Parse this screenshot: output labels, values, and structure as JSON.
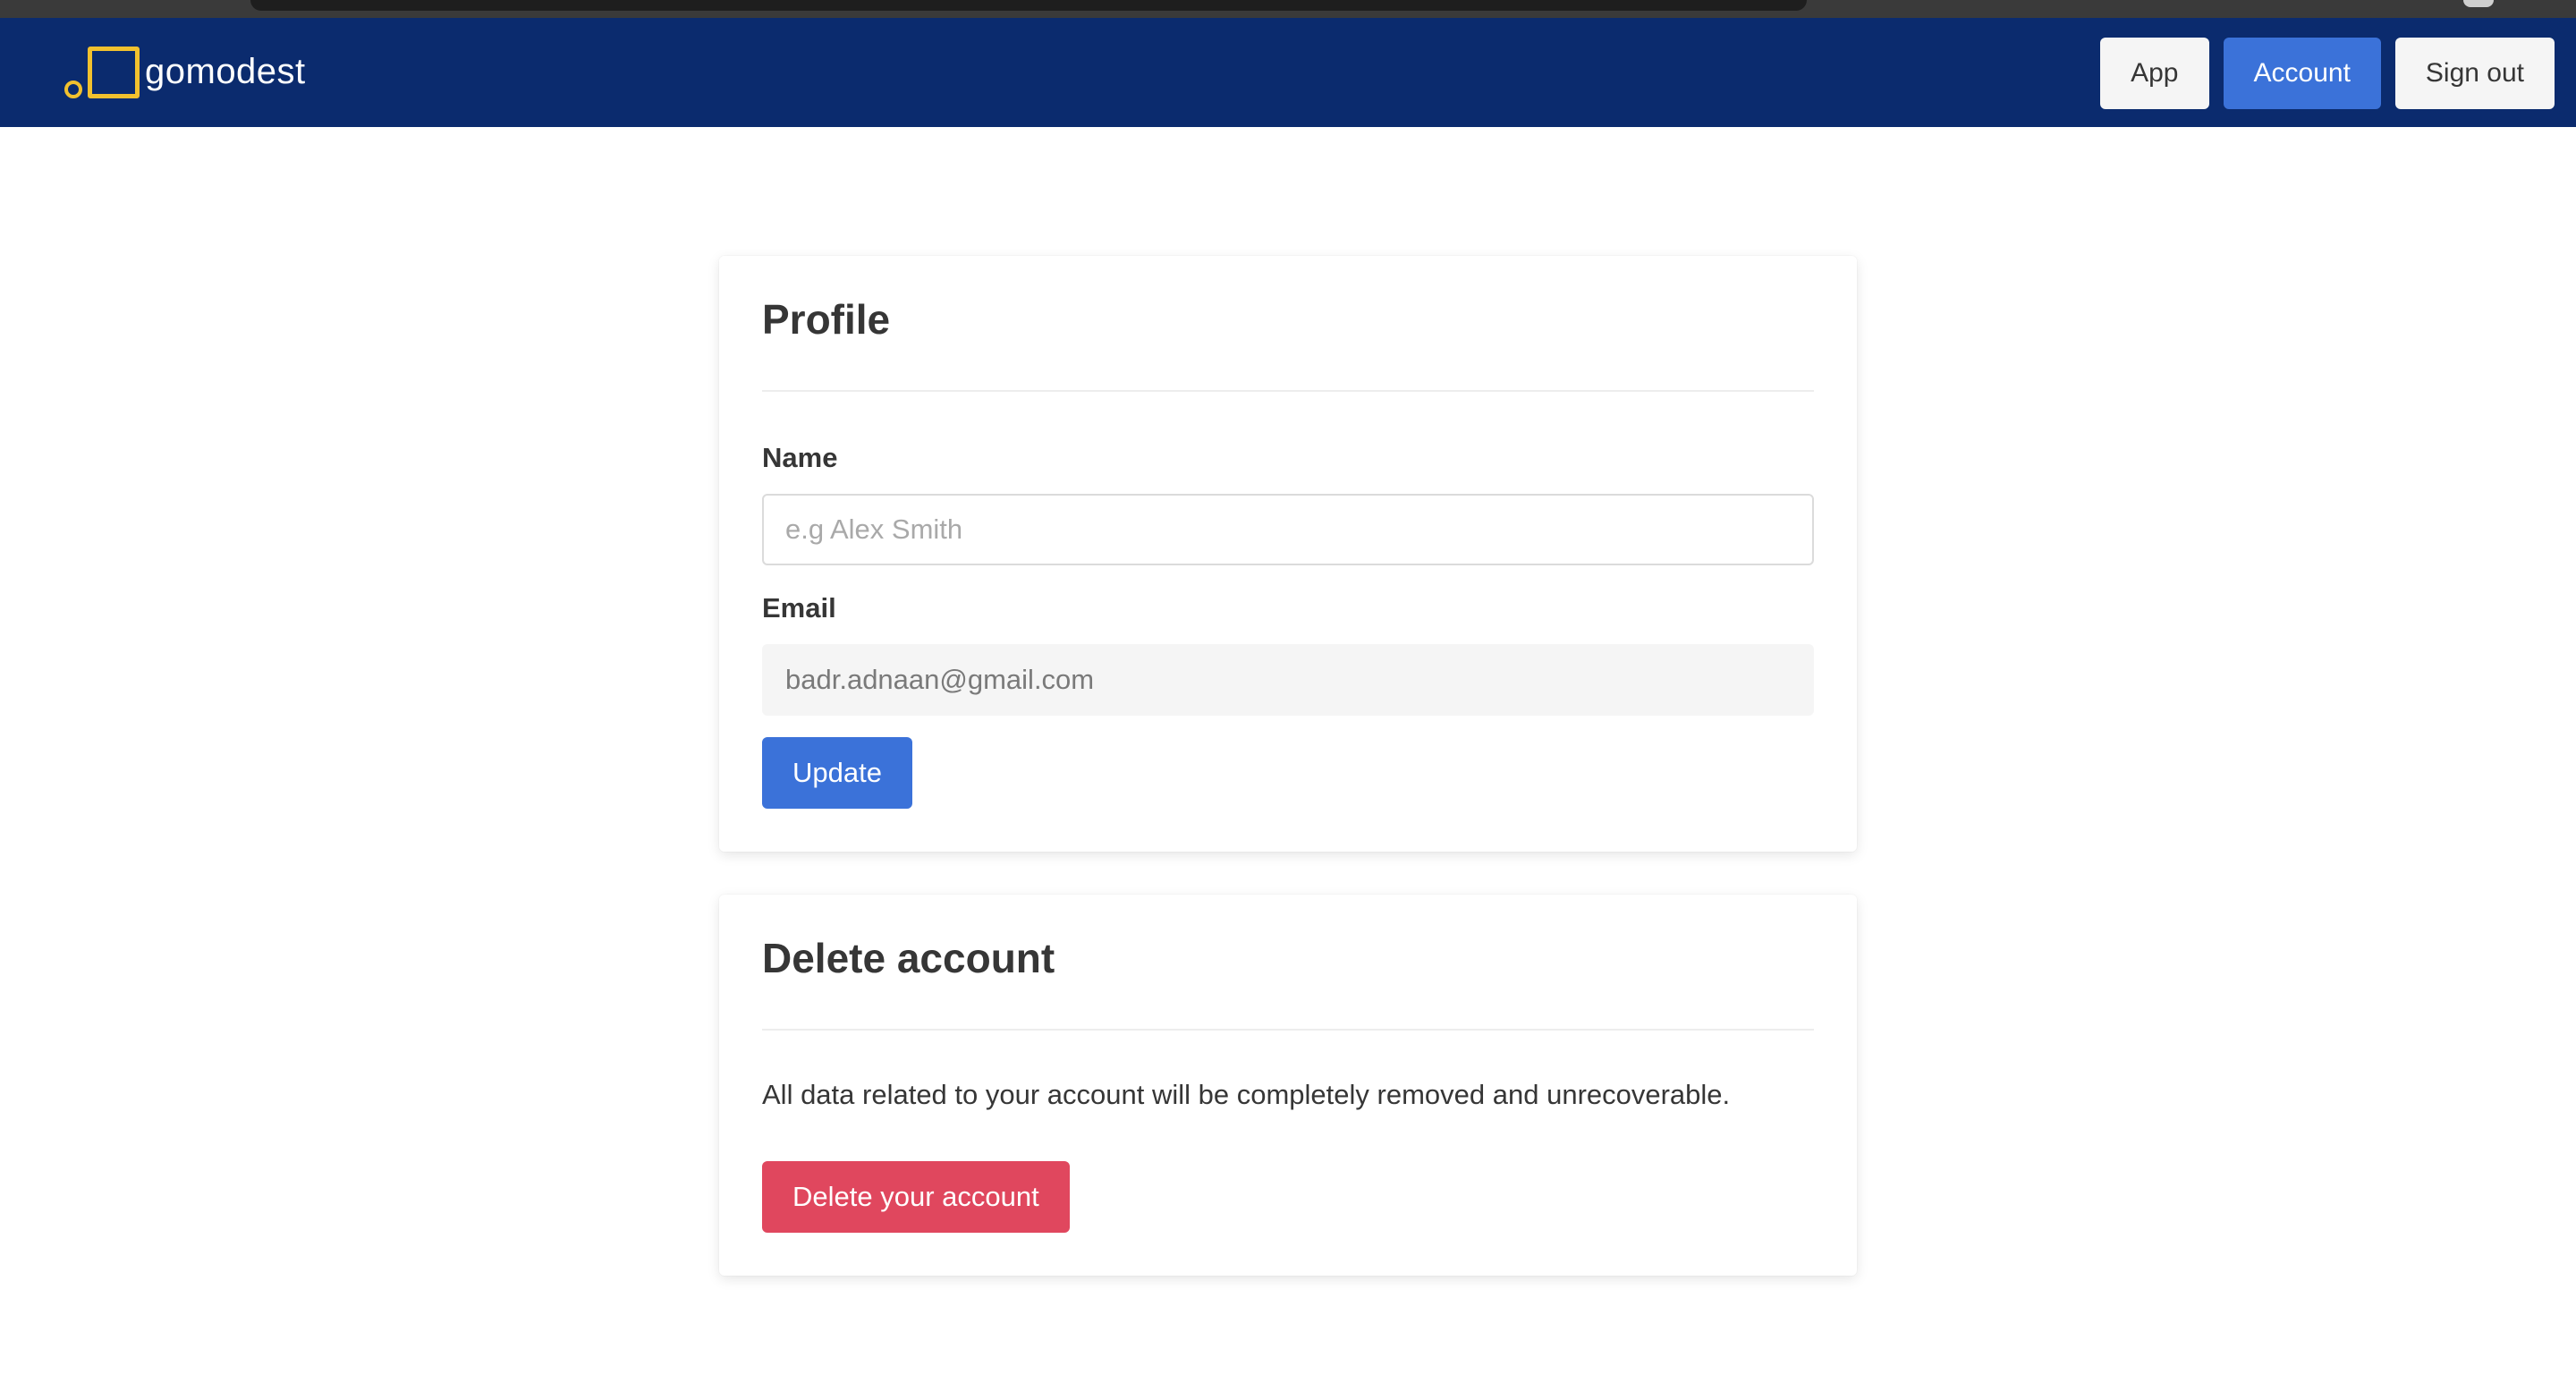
{
  "navbar": {
    "brand_name": "gomodest",
    "buttons": [
      {
        "label": "App"
      },
      {
        "label": "Account"
      },
      {
        "label": "Sign out"
      }
    ]
  },
  "profile": {
    "title": "Profile",
    "name_label": "Name",
    "name_value": "",
    "name_placeholder": "e.g Alex Smith",
    "email_label": "Email",
    "email_value": "badr.adnaan@gmail.com",
    "update_label": "Update"
  },
  "delete_account": {
    "title": "Delete account",
    "description": "All data related to your account will be completely removed and unrecoverable.",
    "button_label": "Delete your account"
  },
  "colors": {
    "navbar_bg": "#0b2b6e",
    "logo_accent": "#f2c12e",
    "primary": "#3b72d9",
    "danger": "#e0475e"
  }
}
